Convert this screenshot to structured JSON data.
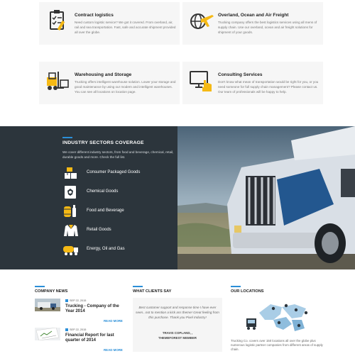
{
  "services": [
    {
      "title": "Contract logistics",
      "icon": "clipboard-icon",
      "desc": "Need custom logistic service? We got it covered. From overland, air, rail and sea transportation. Fast, safe and accurate shipment provided all over the globe."
    },
    {
      "title": "Overland, Ocean and Air Freight",
      "icon": "globe-plane-icon",
      "desc": "Trucking company offers the best logistics services using all mens of supply chain. Use our overland, ocean and air freight solutions for shipment of your goods."
    },
    {
      "title": "Warehousing and Storage",
      "icon": "forklift-icon",
      "desc": "Trucking offers intelligent warehouse solution. Lower your storage and good maintenance by using our modern and intelligent warehouses. You can see all locations on location page."
    },
    {
      "title": "Consulting Services",
      "icon": "monitor-hand-icon",
      "desc": "Don't know what mean of transportation would be right for you, or you need someone for full supply chain management? Please contact us. Our team of professionals will be happy to help."
    }
  ],
  "industry": {
    "title": "INDUSTRY SECTORS COVERAGE",
    "desc": "We cover different industry sectors, from food and beverage, chemical, retail, durable goods and more. Check the full list.",
    "sectors": [
      {
        "label": "Consumer Packaged Goods",
        "icon": "boxes-icon"
      },
      {
        "label": "Chemical Goods",
        "icon": "hazard-icon"
      },
      {
        "label": "Food and Beverage",
        "icon": "barrel-bottle-icon"
      },
      {
        "label": "Retail Goods",
        "icon": "jacket-icon"
      },
      {
        "label": "Energy, Oil and Gas",
        "icon": "tanker-truck-icon"
      }
    ]
  },
  "news": {
    "heading": "COMPANY NEWS",
    "items": [
      {
        "date": "SEP 22, 2015",
        "title": "Trucking - Company of the Year 2014",
        "read_more": "READ MORE"
      },
      {
        "date": "SEP 22, 2015",
        "title": "Financial Report for last quarter of 2014",
        "read_more": "READ MORE"
      }
    ]
  },
  "clients": {
    "heading": "WHAT CLIENTS SAY",
    "quote": "Best customer support and response time I have ever seen...not to mention a kick ass theme! Great feeling from this purchase. Thank you Pixel Industry!",
    "author": "TRAVIS COPLAND, ,",
    "role": "THEMEFOREST MEMBER"
  },
  "locations": {
    "heading": "OUR LOCATIONS",
    "desc": "Trucking Co. covers over 150 locations all over the globe plus numerous logistic partner companies from different areas of supply chain."
  },
  "colors": {
    "accent": "#2b8fd8",
    "icon_yellow": "#f5b915",
    "band_bg": "#2c353c"
  }
}
